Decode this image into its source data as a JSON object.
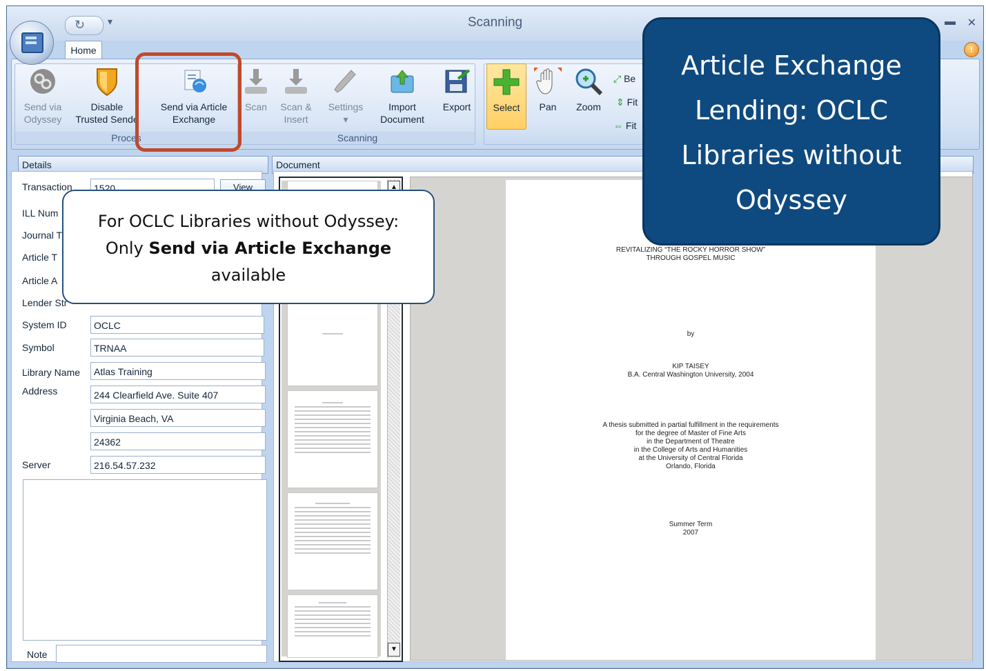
{
  "window": {
    "title": "Scanning",
    "tab": "Home"
  },
  "ribbon": {
    "process": {
      "label": "Proces",
      "send_odyssey": [
        "Send via",
        "Odyssey"
      ],
      "disable_trusted": [
        "Disable",
        "Trusted Sende"
      ],
      "send_article": [
        "Send via Article",
        "Exchange"
      ]
    },
    "scanning": {
      "label": "Scanning",
      "scan": "Scan",
      "scan_insert": [
        "Scan &",
        "Insert"
      ],
      "settings": "Settings",
      "import": [
        "Import",
        "Document"
      ],
      "export": "Export"
    },
    "view": {
      "select": "Select",
      "pan": "Pan",
      "zoom": "Zoom",
      "be": "Be",
      "fit1": "Fit",
      "fit2": "Fit"
    }
  },
  "details": {
    "header": "Details",
    "transaction_label": "Transaction",
    "transaction_value": "1520",
    "view_btn": "View",
    "ill_label": "ILL Num",
    "journal_label": "Journal T",
    "article_title_label": "Article T",
    "article_author_label": "Article A",
    "lender_label": "Lender Str",
    "system_id_label": "System ID",
    "system_id_value": "OCLC",
    "symbol_label": "Symbol",
    "symbol_value": "TRNAA",
    "library_label": "Library Name",
    "library_value": "Atlas Training",
    "address_label": "Address",
    "address1": "244 Clearfield Ave. Suite 407",
    "address2": "Virginia Beach, VA",
    "address3": "24362",
    "server_label": "Server",
    "server_value": "216.54.57.232",
    "note_label": "Note"
  },
  "document": {
    "header": "Document",
    "page_lines": [
      "REVITALIZING “THE ROCKY HORROR SHOW”",
      "THROUGH GOSPEL MUSIC",
      "by",
      "KIP TAISEY",
      "B.A. Central Washington University, 2004",
      "A thesis submitted in partial fulfillment in the requirements",
      "for the degree of Master of Fine Arts",
      "in the Department of Theatre",
      "in the College of Arts and Humanities",
      "at the University of Central Florida",
      "Orlando, Florida",
      "Summer Term",
      "2007"
    ]
  },
  "callouts": {
    "left_line1": "For OCLC Libraries without Odyssey:",
    "left_line2_pre": "Only ",
    "left_line2_bold": "Send via Article Exchange",
    "left_line3": "available",
    "right_line1": "Article Exchange",
    "right_line2": "Lending: OCLC",
    "right_line3": "Libraries without",
    "right_line4": "Odyssey"
  },
  "colors": {
    "callout_bg": "#0e4a80",
    "highlight": "#c0492b",
    "ribbon": "#d5e3f5"
  }
}
